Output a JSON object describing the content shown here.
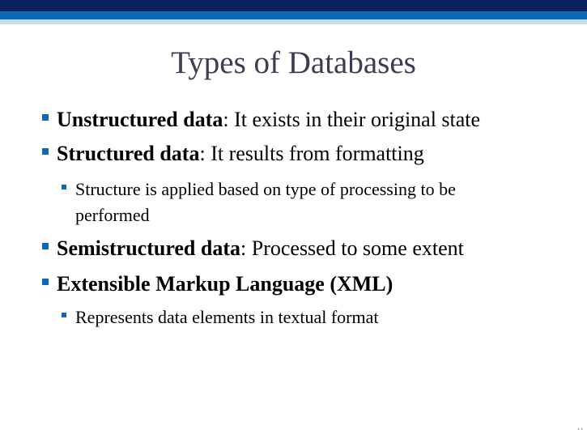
{
  "slide": {
    "title": "Types of Databases",
    "bullets": [
      {
        "bold": "Unstructured data",
        "rest": ": It exists in their original state"
      },
      {
        "bold": "Structured data",
        "rest": ": It results from formatting"
      },
      {
        "line1": "Structure is applied based on type of processing to be",
        "line2": "performed"
      },
      {
        "bold": "Semistructured data",
        "rest": ": Processed to some extent"
      },
      {
        "bold": "Extensible Markup Language (XML)",
        "rest": ""
      },
      {
        "text": "Represents data elements in textual format"
      }
    ],
    "slide_number": "11"
  },
  "colors": {
    "band_dark": "#0b2160",
    "band_mid": "#0f67b8",
    "band_light": "#c6ddf1",
    "bullet": "#0f67b8",
    "title": "#3c3c52"
  }
}
